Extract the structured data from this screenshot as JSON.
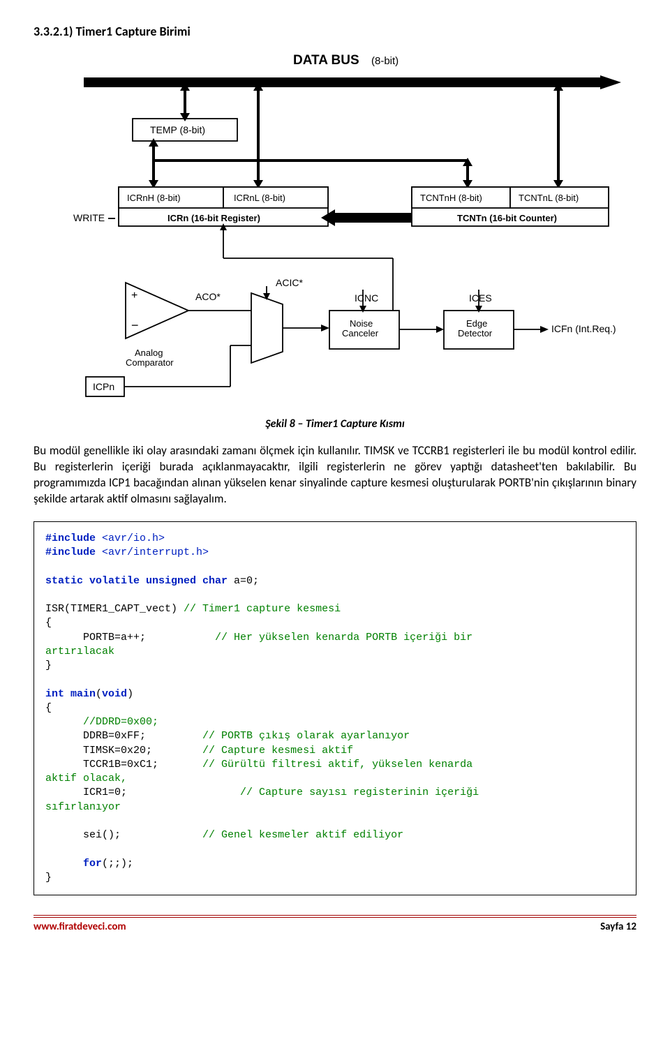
{
  "heading": "3.3.2.1) Timer1 Capture Birimi",
  "diagram": {
    "databus": "DATA BUS",
    "databus_bits": "(8-bit)",
    "temp": "TEMP (8-bit)",
    "icrnh": "ICRnH (8-bit)",
    "icrnl": "ICRnL (8-bit)",
    "tcnth": "TCNTnH (8-bit)",
    "tcntl": "TCNTnL (8-bit)",
    "icrn": "ICRn (16-bit Register)",
    "tcntn": "TCNTn (16-bit Counter)",
    "write": "WRITE",
    "analog_comp": "Analog\nComparator",
    "aco": "ACO*",
    "acic": "ACIC*",
    "noise": "Noise\nCanceler",
    "icnc": "ICNC",
    "edge": "Edge\nDetector",
    "ices": "ICES",
    "icpn": "ICPn",
    "icfn": "ICFn (Int.Req.)"
  },
  "caption": "Şekil 8 – Timer1 Capture Kısmı",
  "paragraph": "Bu modül genellikle iki olay arasındaki zamanı ölçmek için kullanılır. TIMSK ve TCCRB1 registerleri ile bu modül kontrol edilir. Bu registerlerin içeriği burada açıklanmayacaktır, ilgili registerlerin ne görev yaptığı datasheet'ten bakılabilir. Bu programımızda ICP1 bacağından alınan yükselen kenar sinyalinde capture kesmesi oluşturularak PORTB'nin çıkışlarının binary şekilde artarak aktif olmasını sağlayalım.",
  "code": {
    "inc1": "#include",
    "inc1h": " <avr/io.h>",
    "inc2": "#include",
    "inc2h": " <avr/interrupt.h>",
    "decl1": "static volatile unsigned char",
    "decl1b": " a=0;",
    "isr_head": "ISR(TIMER1_CAPT_vect) ",
    "isr_cmt": "// Timer1 capture kesmesi",
    "brace_open": "{",
    "isr_body1a": "      PORTB=a++;           ",
    "isr_body1c": "// Her yükselen kenarda PORTB içeriği bir",
    "isr_body2": "artırılacak",
    "brace_close": "}",
    "main1": "int",
    "main2": " main",
    "main3": "(",
    "main4": "void",
    "main5": ")",
    "m_ddrcmt": "      //DDRD=0x00;",
    "m_ddrb": "      DDRB=0xFF;         ",
    "m_ddrb_c": "// PORTB çıkış olarak ayarlanıyor",
    "m_timsk": "      TIMSK=0x20;        ",
    "m_timsk_c": "// Capture kesmesi aktif",
    "m_tccr": "      TCCR1B=0xC1;       ",
    "m_tccr_c": "// Gürültü filtresi aktif, yükselen kenarda",
    "m_aktif": "aktif olacak,",
    "m_icr": "      ICR1=0;                  ",
    "m_icr_c": "// Capture sayısı registerinin içeriği",
    "m_sifir": "sıfırlanıyor",
    "m_sei": "      sei();             ",
    "m_sei_c": "// Genel kesmeler aktif ediliyor",
    "m_for1": "      for",
    "m_for2": "(;;);"
  },
  "footer": {
    "left": "www.firatdeveci.com",
    "right": "Sayfa 12"
  }
}
